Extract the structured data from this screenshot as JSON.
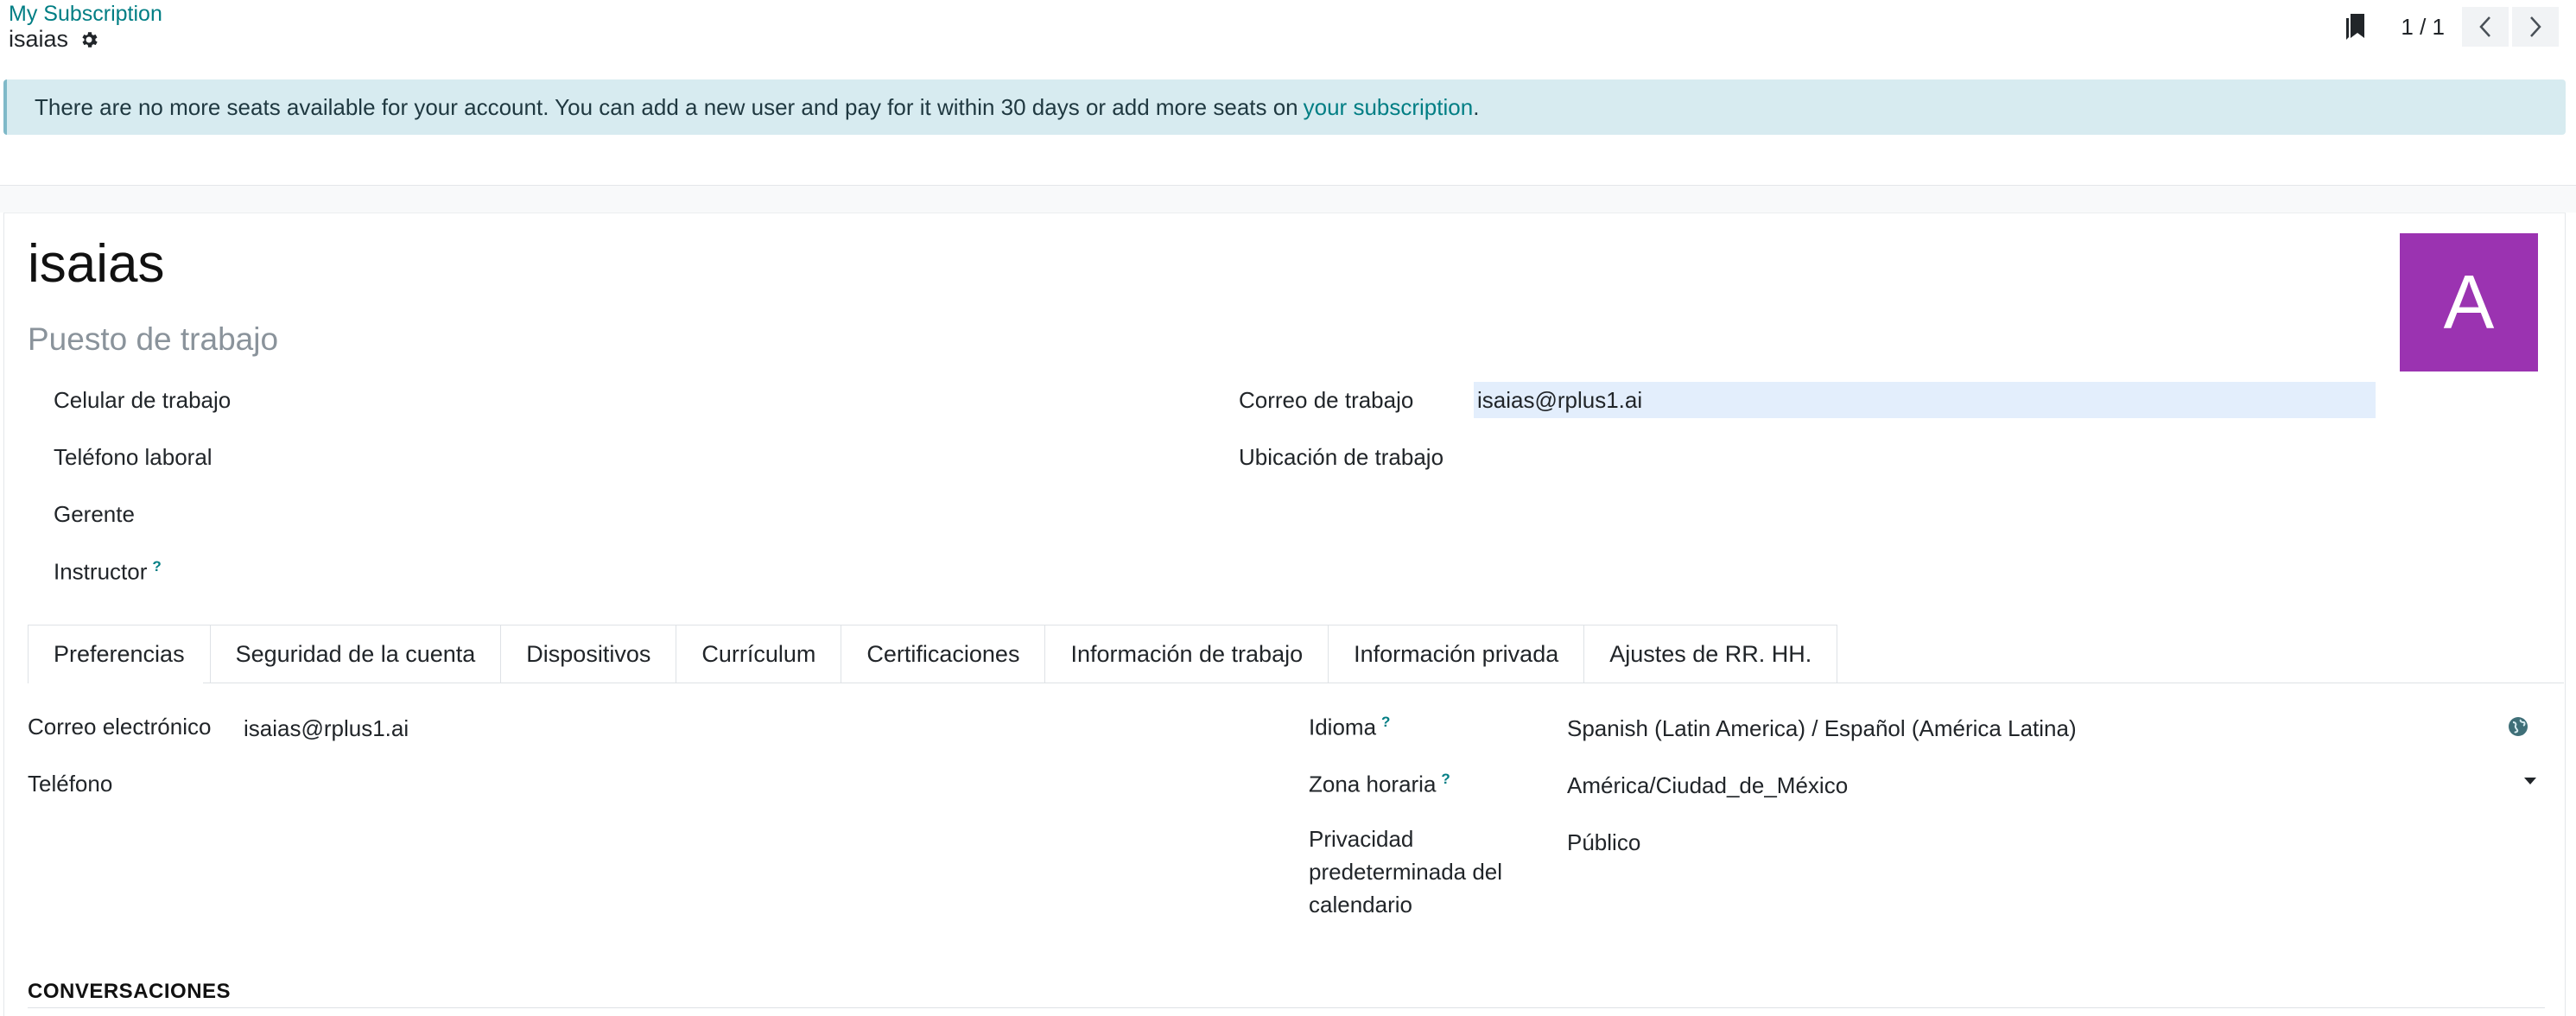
{
  "breadcrumb": {
    "parent": "My Subscription",
    "current": "isaias"
  },
  "pager": {
    "value": "1 / 1"
  },
  "alert": {
    "text": "There are no more seats available for your account. You can add a new user and pay for it within 30 days or add more seats on",
    "link": "your subscription",
    "suffix": "."
  },
  "employee": {
    "name": "isaias",
    "job_placeholder": "Puesto de trabajo",
    "avatar_letter": "A",
    "avatar_color": "#9b33b1"
  },
  "fields_left": {
    "mobile": "Celular de trabajo",
    "phone": "Teléfono laboral",
    "manager": "Gerente",
    "coach": "Instructor",
    "help": "?"
  },
  "fields_right": {
    "work_email_label": "Correo de trabajo",
    "work_email_value": "isaias@rplus1.ai",
    "work_location": "Ubicación de trabajo"
  },
  "tabs": [
    "Preferencias",
    "Seguridad de la cuenta",
    "Dispositivos",
    "Currículum",
    "Certificaciones",
    "Información de trabajo",
    "Información privada",
    "Ajustes de RR. HH."
  ],
  "preferences": {
    "email_label": "Correo electrónico",
    "email_value": "isaias@rplus1.ai",
    "phone_label": "Teléfono",
    "language_label": "Idioma",
    "language_value": "Spanish (Latin America) / Español (América Latina)",
    "tz_label": "Zona horaria",
    "tz_value": "América/Ciudad_de_México",
    "privacy_label_1": "Privacidad",
    "privacy_label_2": "predeterminada del",
    "privacy_label_3": "calendario",
    "privacy_value": "Público",
    "help": "?"
  },
  "section": {
    "title": "CONVERSACIONES"
  },
  "colors": {
    "accent": "#017e84",
    "alert_bg": "#d7ebf0"
  }
}
